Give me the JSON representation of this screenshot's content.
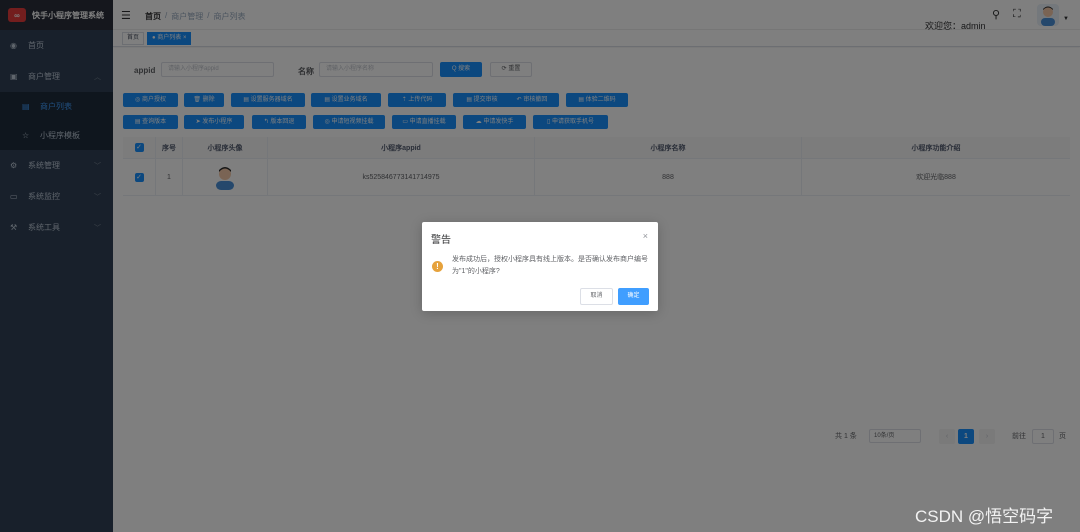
{
  "app": {
    "logo_glyph": "∞",
    "title": "快手小程序管理系统"
  },
  "sidebar": {
    "items": [
      {
        "label": "首页",
        "icon": "dashboard-icon"
      },
      {
        "label": "商户管理",
        "icon": "shop-icon"
      },
      {
        "label": "商户列表",
        "icon": "list-icon"
      },
      {
        "label": "小程序模板",
        "icon": "star-icon"
      },
      {
        "label": "系统管理",
        "icon": "gear-icon"
      },
      {
        "label": "系统监控",
        "icon": "monitor-icon"
      },
      {
        "label": "系统工具",
        "icon": "tool-icon"
      }
    ]
  },
  "navbar": {
    "breadcrumb": [
      "首页",
      "/",
      "商户管理",
      "/",
      "商户列表"
    ],
    "welcome": "欢迎您：admin"
  },
  "tags": {
    "home": "首页",
    "current": "● 商户列表 ×"
  },
  "search": {
    "appid_label": "appid",
    "appid_placeholder": "请输入小程序appid",
    "name_label": "名称",
    "name_placeholder": "请输入小程序名称",
    "search_btn": "Q 搜索",
    "reset_btn": "⟳ 重置"
  },
  "toolbar": {
    "row1": [
      "◎ 商户授权",
      "🗑 删除",
      "▤ 设置服务器域名",
      "▤ 设置业务域名",
      "⇡ 上传代码",
      "▤ 提交审核",
      "↶ 审核撤回",
      "▤ 体验二维码"
    ],
    "row2": [
      "▤ 查询版本",
      "➤ 发布小程序",
      "↰ 版本回退",
      "◎ 申请短视频挂载",
      "▭ 申请直播挂载",
      "☁ 申请发快手",
      "▯ 申请获取手机号"
    ]
  },
  "table": {
    "headers": [
      "序号",
      "小程序头像",
      "小程序appid",
      "小程序名称",
      "小程序功能介绍"
    ],
    "rows": [
      {
        "index": "1",
        "appid": "ks525846773141714975",
        "name": "888",
        "intro": "欢迎光临888"
      }
    ]
  },
  "pagination": {
    "total": "共 1 条",
    "page_size": "10条/页",
    "prev": "‹",
    "current": "1",
    "next": "›",
    "goto_prefix": "前往",
    "goto_value": "1",
    "goto_suffix": "页"
  },
  "dialog": {
    "title": "警告",
    "close": "×",
    "warn_glyph": "!",
    "message": "发布成功后，授权小程序具有线上版本。是否确认发布商户编号为\"1\"的小程序?",
    "cancel": "取消",
    "confirm": "确定"
  },
  "watermark": "CSDN @悟空码字",
  "colors": {
    "sidebar_bg": "#304156",
    "primary": "#1890ff",
    "warning": "#e6a23c"
  }
}
